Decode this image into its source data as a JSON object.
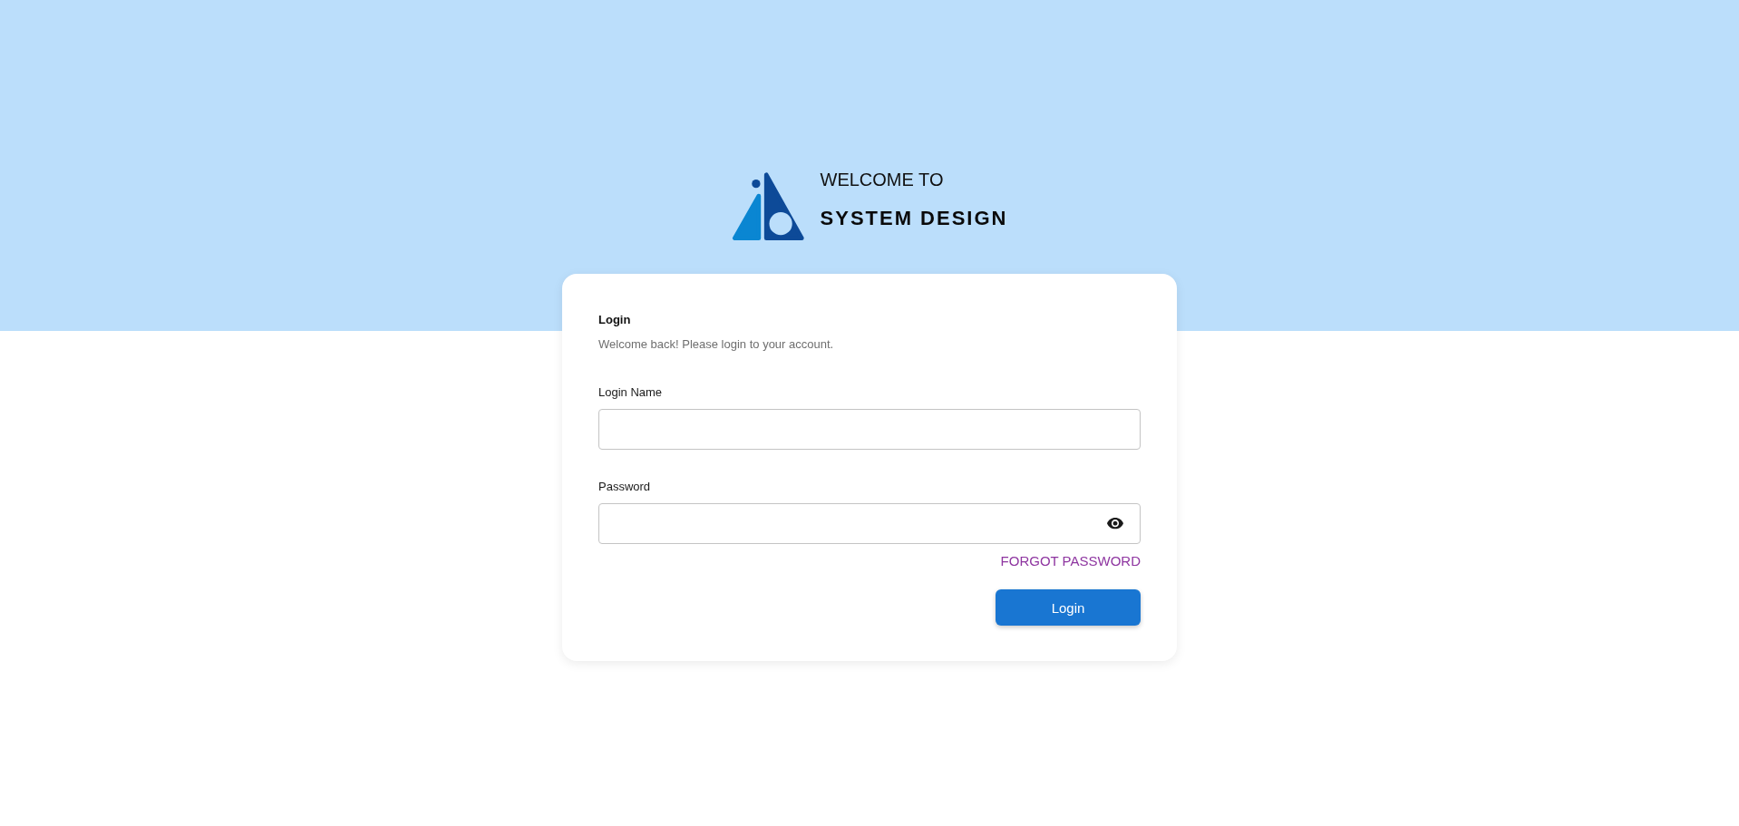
{
  "header": {
    "title": "WELCOME TO",
    "subtitle": "SYSTEM DESIGN"
  },
  "login_card": {
    "title": "Login",
    "subtitle": "Welcome back! Please login to your account.",
    "fields": [
      {
        "label": "Login Name",
        "kind": "text"
      },
      {
        "label": "Password",
        "kind": "password"
      }
    ],
    "forgot_link": "FORGOT PASSWORD",
    "submit_button": "Login"
  }
}
